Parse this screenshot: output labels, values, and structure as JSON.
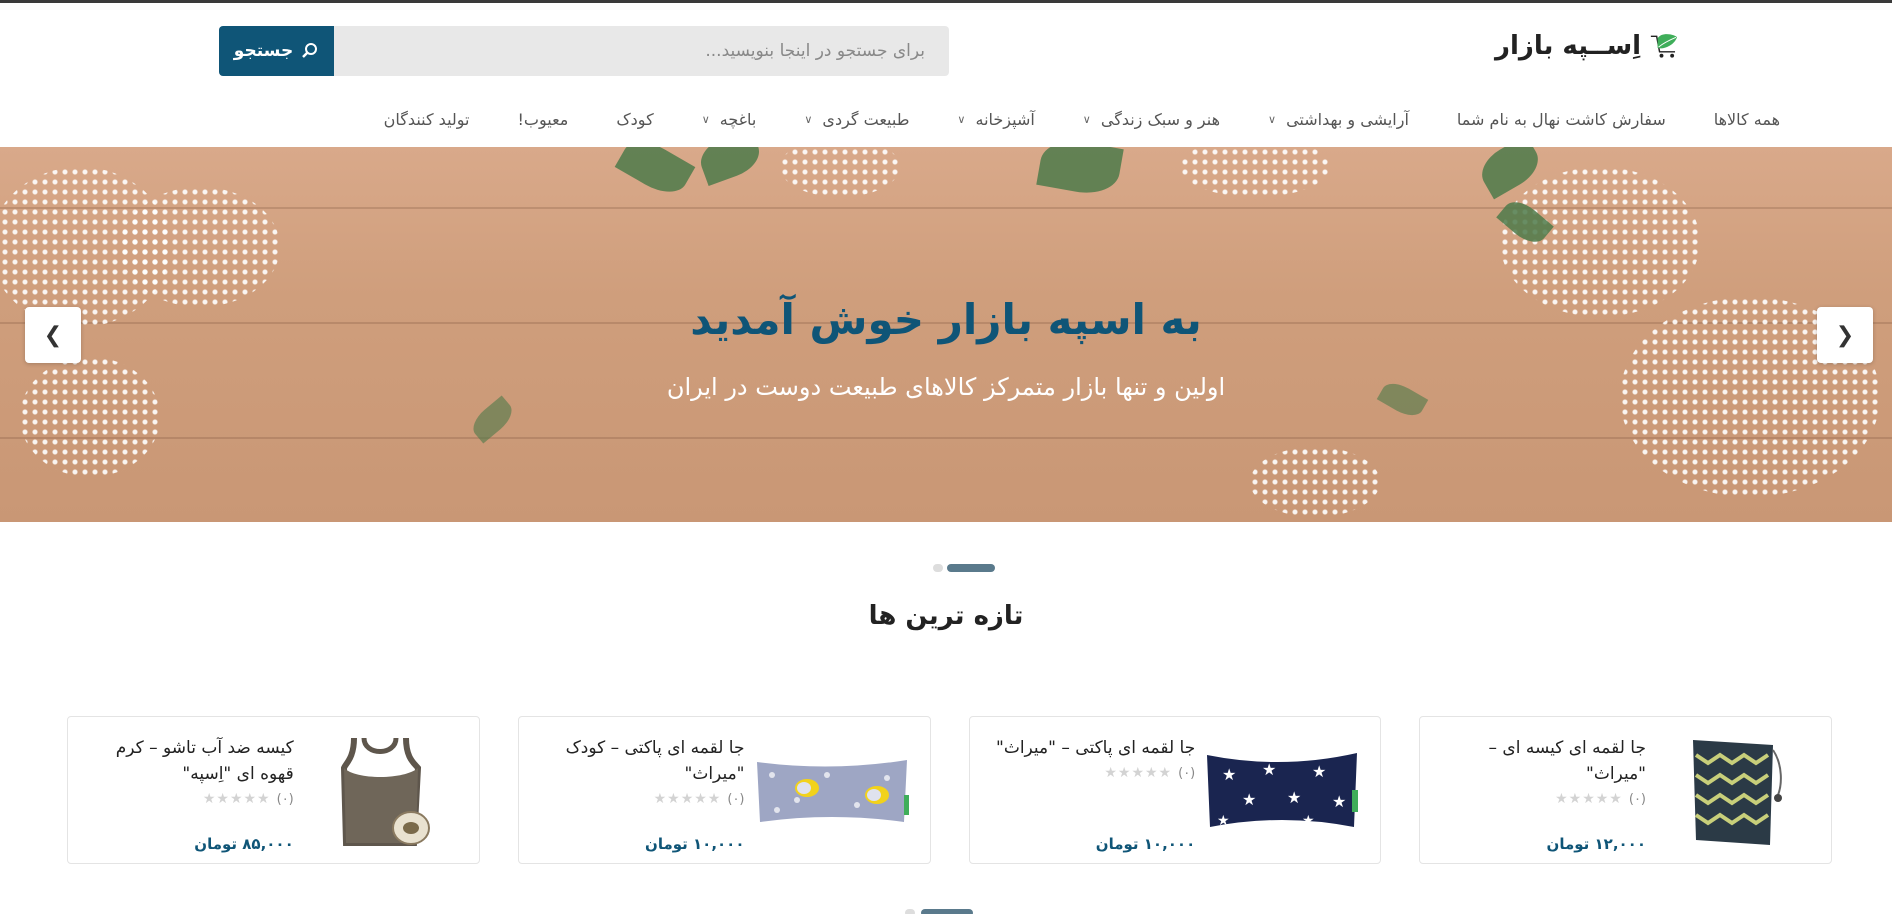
{
  "header": {
    "logo_text": "اِســپه بازار",
    "search_placeholder": "برای جستجو در اینجا بنویسید...",
    "search_button": "جستجو"
  },
  "nav": {
    "items": [
      {
        "label": "همه کالاها",
        "dropdown": false
      },
      {
        "label": "سفارش کاشت نهال به نام شما",
        "dropdown": false
      },
      {
        "label": "آرایشی و بهداشتی",
        "dropdown": true
      },
      {
        "label": "هنر و سبک زندگی",
        "dropdown": true
      },
      {
        "label": "آشپزخانه",
        "dropdown": true
      },
      {
        "label": "طبیعت گردی",
        "dropdown": true
      },
      {
        "label": "باغچه",
        "dropdown": true
      },
      {
        "label": "کودک",
        "dropdown": false
      },
      {
        "label": "معیوب!",
        "dropdown": false
      },
      {
        "label": "تولید کنندگان",
        "dropdown": false
      }
    ]
  },
  "hero": {
    "title": "به اسپه بازار خوش آمدید",
    "subtitle": "اولین و تنها بازار متمرکز کالاهای طبیعت دوست در ایران"
  },
  "section": {
    "title": "تازه ترین ها"
  },
  "products": [
    {
      "title": "جا لقمه ای کیسه ای – \"میراث\"",
      "rating_count": "(۰)",
      "price": "۱۲,۰۰۰ تومان",
      "image": "zigzag-bag"
    },
    {
      "title": "جا لقمه ای پاکتی – \"میراث\"",
      "rating_count": "(۰)",
      "price": "۱۰,۰۰۰ تومان",
      "image": "star-pouch"
    },
    {
      "title": "جا لقمه ای پاکتی – کودک \"میراث\"",
      "rating_count": "(۰)",
      "price": "۱۰,۰۰۰ تومان",
      "image": "elephant-pouch"
    },
    {
      "title": "کیسه ضد آب تاشو – کرم قهوه ای \"اِسپه\"",
      "rating_count": "(۰)",
      "price": "۸۵,۰۰۰ تومان",
      "image": "tote-bag"
    }
  ],
  "colors": {
    "brand": "#0f5577",
    "logo_green": "#3fae5a"
  }
}
